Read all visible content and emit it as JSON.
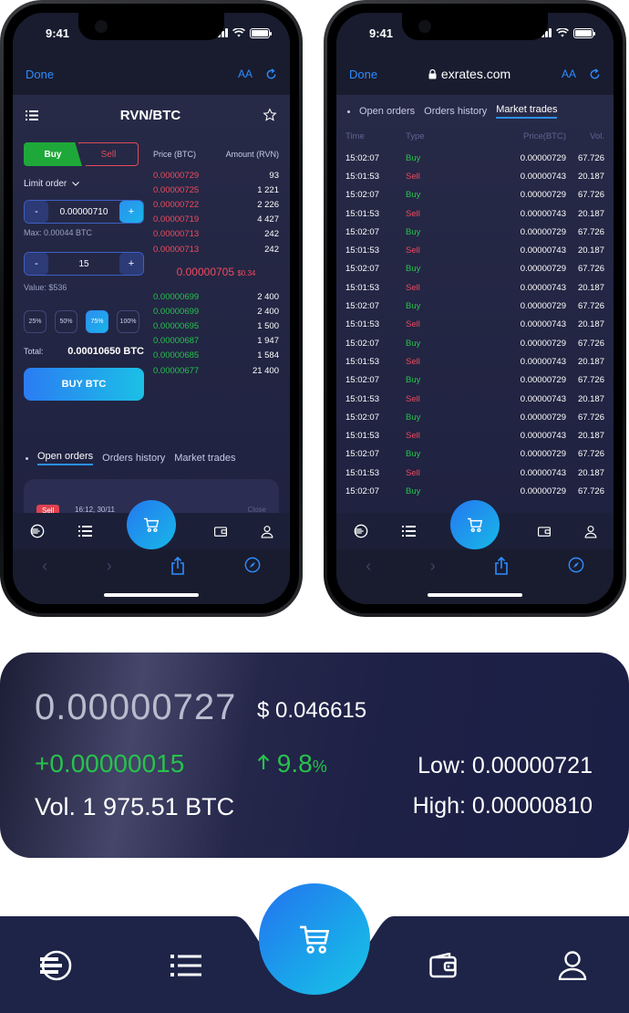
{
  "left_phone": {
    "status_time": "9:41",
    "browser": {
      "done": "Done",
      "aa": "AA"
    },
    "pair": "RVN/BTC",
    "buy_label": "Buy",
    "sell_label": "Sell",
    "order_type": "Limit order",
    "price_value": "0.00000710",
    "max_hint": "Max: 0.00044 BTC",
    "amount_value": "15",
    "value_hint": "Value: $536",
    "percent_options": [
      "25%",
      "50%",
      "75%",
      "100%"
    ],
    "selected_percent": "75%",
    "total_label": "Total:",
    "total_value": "0.00010650 BTC",
    "buy_button": "BUY BTC",
    "book_header": {
      "price": "Price (BTC)",
      "amount": "Amount (RVN)"
    },
    "asks": [
      {
        "price": "0.00000729",
        "amount": "93"
      },
      {
        "price": "0.00000725",
        "amount": "1 221"
      },
      {
        "price": "0.00000722",
        "amount": "2 226"
      },
      {
        "price": "0.00000719",
        "amount": "4 427"
      },
      {
        "price": "0.00000713",
        "amount": "242"
      },
      {
        "price": "0.00000713",
        "amount": "242"
      }
    ],
    "mid_price": "0.00000705",
    "mid_usd": "$0.34",
    "bids": [
      {
        "price": "0.00000699",
        "amount": "2 400"
      },
      {
        "price": "0.00000699",
        "amount": "2 400"
      },
      {
        "price": "0.00000695",
        "amount": "1 500"
      },
      {
        "price": "0.00000687",
        "amount": "1 947"
      },
      {
        "price": "0.00000685",
        "amount": "1 584"
      },
      {
        "price": "0.00000677",
        "amount": "21 400"
      }
    ],
    "tabs": [
      "Open orders",
      "Orders history",
      "Market trades"
    ],
    "active_tab": "Open orders",
    "order": {
      "side": "Sell",
      "time": "16:12, 30/11",
      "close": "Close"
    }
  },
  "right_phone": {
    "status_time": "9:41",
    "browser": {
      "done": "Done",
      "url": "exrates.com",
      "aa": "AA"
    },
    "tabs": [
      "Open orders",
      "Orders history",
      "Market trades"
    ],
    "active_tab": "Market trades",
    "columns": {
      "time": "Time",
      "type": "Type",
      "price": "Price(BTC)",
      "vol": "Vol."
    },
    "trades": [
      {
        "time": "15:02:07",
        "type": "Buy",
        "price": "0.00000729",
        "vol": "67.726"
      },
      {
        "time": "15:01:53",
        "type": "Sell",
        "price": "0.00000743",
        "vol": "20.187"
      },
      {
        "time": "15:02:07",
        "type": "Buy",
        "price": "0.00000729",
        "vol": "67.726"
      },
      {
        "time": "15:01:53",
        "type": "Sell",
        "price": "0.00000743",
        "vol": "20.187"
      },
      {
        "time": "15:02:07",
        "type": "Buy",
        "price": "0.00000729",
        "vol": "67.726"
      },
      {
        "time": "15:01:53",
        "type": "Sell",
        "price": "0.00000743",
        "vol": "20.187"
      },
      {
        "time": "15:02:07",
        "type": "Buy",
        "price": "0.00000729",
        "vol": "67.726"
      },
      {
        "time": "15:01:53",
        "type": "Sell",
        "price": "0.00000743",
        "vol": "20.187"
      },
      {
        "time": "15:02:07",
        "type": "Buy",
        "price": "0.00000729",
        "vol": "67.726"
      },
      {
        "time": "15:01:53",
        "type": "Sell",
        "price": "0.00000743",
        "vol": "20.187"
      },
      {
        "time": "15:02:07",
        "type": "Buy",
        "price": "0.00000729",
        "vol": "67.726"
      },
      {
        "time": "15:01:53",
        "type": "Sell",
        "price": "0.00000743",
        "vol": "20.187"
      },
      {
        "time": "15:02:07",
        "type": "Buy",
        "price": "0.00000729",
        "vol": "67.726"
      },
      {
        "time": "15:01:53",
        "type": "Sell",
        "price": "0.00000743",
        "vol": "20.187"
      },
      {
        "time": "15:02:07",
        "type": "Buy",
        "price": "0.00000729",
        "vol": "67.726"
      },
      {
        "time": "15:01:53",
        "type": "Sell",
        "price": "0.00000743",
        "vol": "20.187"
      },
      {
        "time": "15:02:07",
        "type": "Buy",
        "price": "0.00000729",
        "vol": "67.726"
      },
      {
        "time": "15:01:53",
        "type": "Sell",
        "price": "0.00000743",
        "vol": "20.187"
      },
      {
        "time": "15:02:07",
        "type": "Buy",
        "price": "0.00000729",
        "vol": "67.726"
      }
    ]
  },
  "price_card": {
    "price": "0.00000727",
    "usd": "$ 0.046615",
    "change": "+0.00000015",
    "change_pct": "9.8",
    "pct_sign": "%",
    "volume": "Vol. 1 975.51 BTC",
    "low": "Low: 0.00000721",
    "high": "High: 0.00000810"
  },
  "colors": {
    "accent": "#2b8ff0",
    "buy": "#27c24c",
    "sell": "#f04a5e",
    "nav_bg": "#1d2448"
  },
  "nav_icons": [
    "exrates-logo-icon",
    "list-icon",
    "cart-icon",
    "wallet-icon",
    "user-icon"
  ]
}
